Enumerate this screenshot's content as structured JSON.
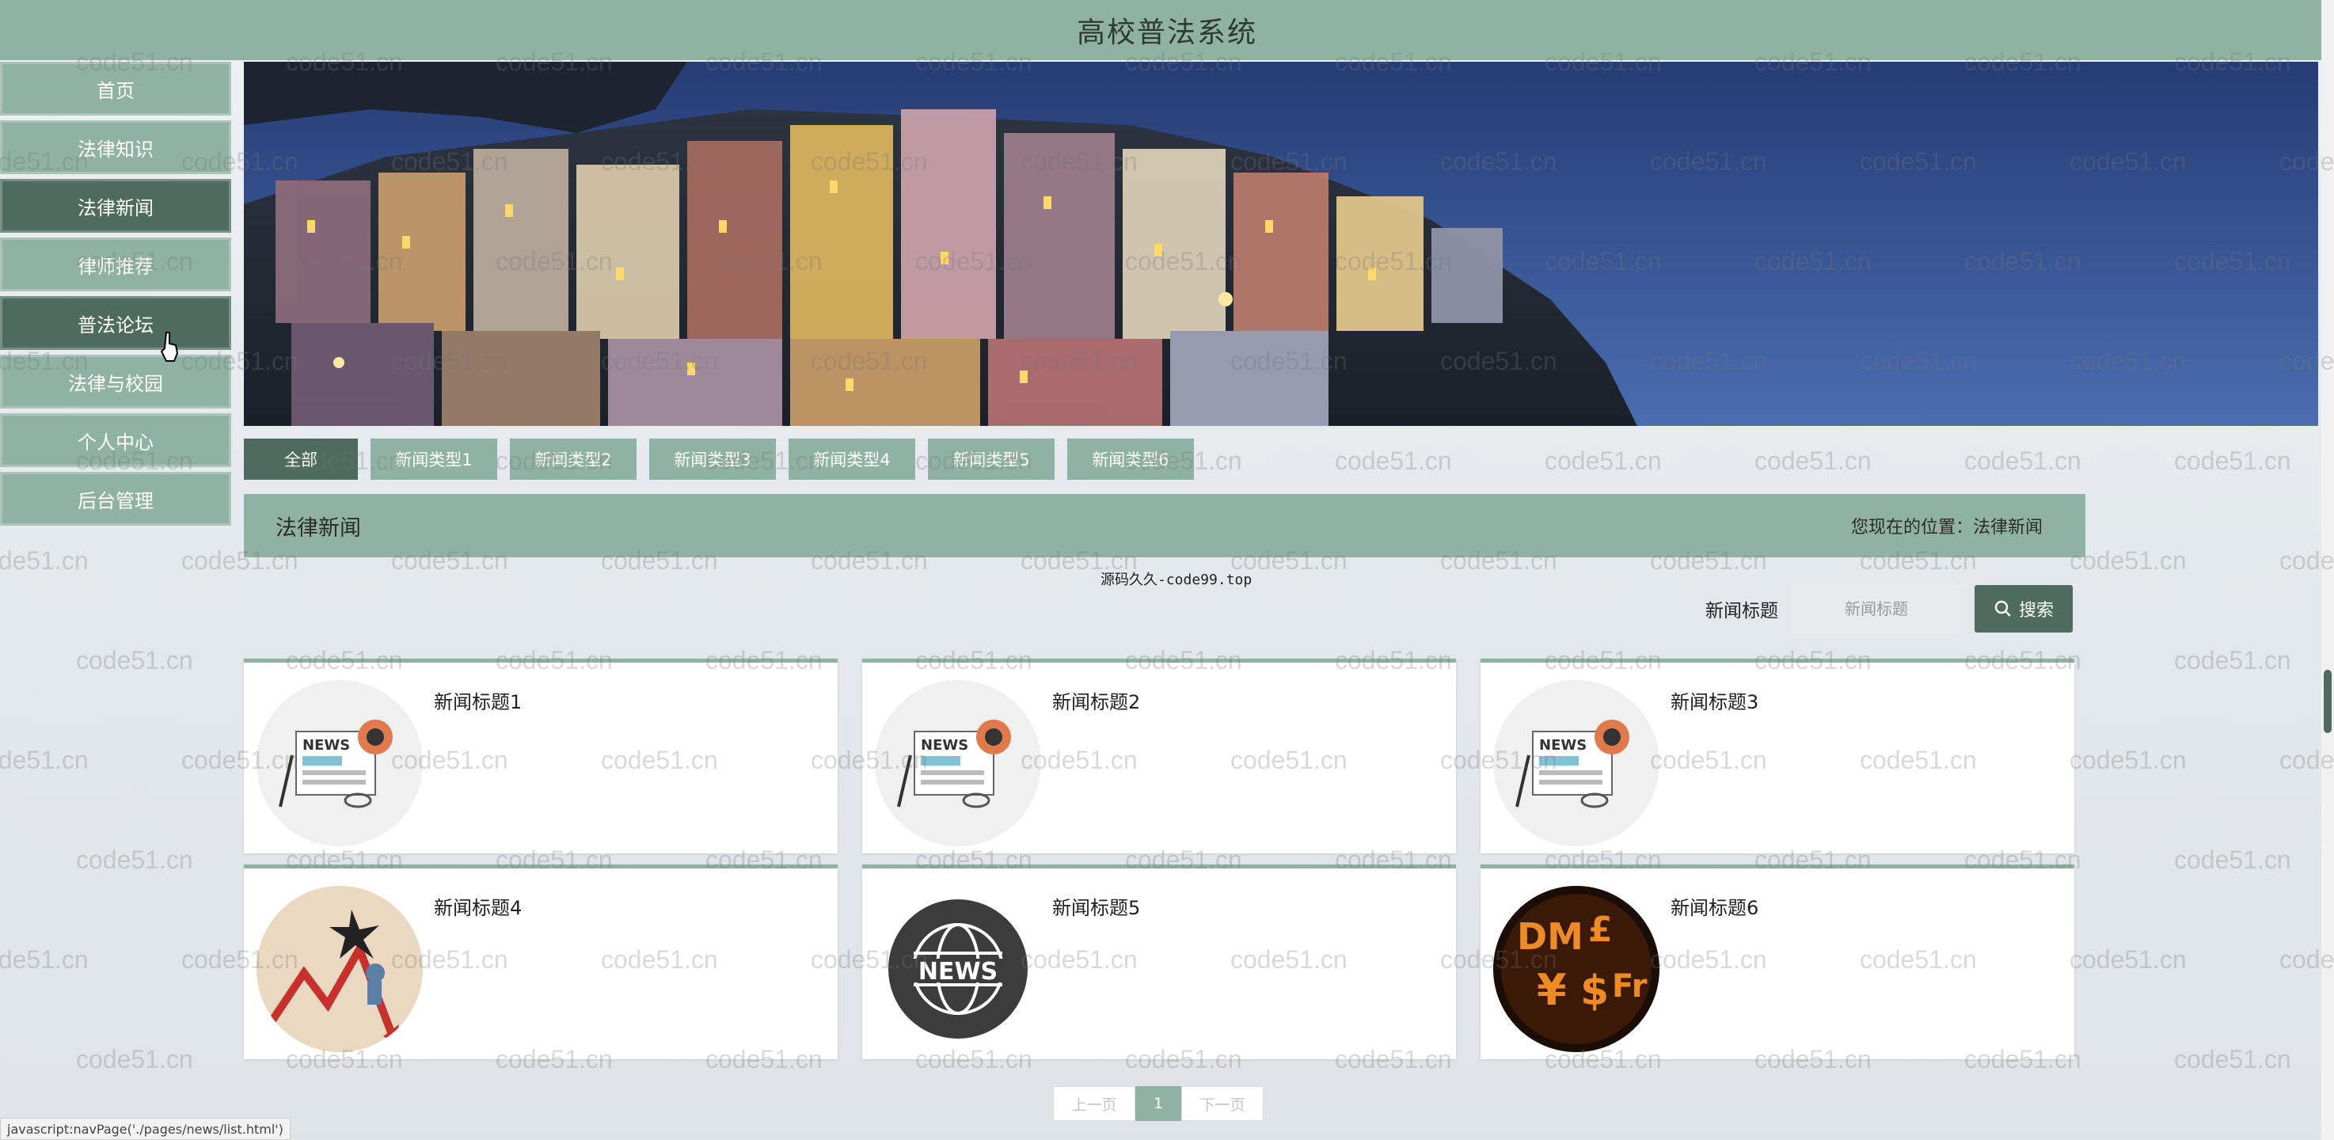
{
  "header": {
    "title": "高校普法系统"
  },
  "sidebar": {
    "items": [
      {
        "label": "首页"
      },
      {
        "label": "法律知识"
      },
      {
        "label": "法律新闻"
      },
      {
        "label": "律师推荐"
      },
      {
        "label": "普法论坛"
      },
      {
        "label": "法律与校园"
      },
      {
        "label": "个人中心"
      },
      {
        "label": "后台管理"
      }
    ],
    "active_index": 2,
    "hover_index": 4
  },
  "tabs": {
    "items": [
      {
        "label": "全部"
      },
      {
        "label": "新闻类型1"
      },
      {
        "label": "新闻类型2"
      },
      {
        "label": "新闻类型3"
      },
      {
        "label": "新闻类型4"
      },
      {
        "label": "新闻类型5"
      },
      {
        "label": "新闻类型6"
      }
    ]
  },
  "section": {
    "title": "法律新闻",
    "location": "您现在的位置：法律新闻"
  },
  "source_note": "源码久久-code99.top",
  "search": {
    "label": "新闻标题",
    "placeholder": "新闻标题",
    "button": "搜索"
  },
  "news": [
    {
      "title": "新闻标题1",
      "image": "news-paper-icon"
    },
    {
      "title": "新闻标题2",
      "image": "news-paper-icon"
    },
    {
      "title": "新闻标题3",
      "image": "news-paper-icon"
    },
    {
      "title": "新闻标题4",
      "image": "market-crash-chart"
    },
    {
      "title": "新闻标题5",
      "image": "news-globe-icon"
    },
    {
      "title": "新闻标题6",
      "image": "currency-symbols"
    }
  ],
  "pager": {
    "prev": "上一页",
    "page": "1",
    "next": "下一页"
  },
  "status_url": "javascript:navPage('./pages/news/list.html')",
  "watermark": "code51.cn",
  "colors": {
    "accent": "#8fb2a4",
    "accent_dark": "#4d6b5e",
    "header": "#8fb2a4"
  }
}
